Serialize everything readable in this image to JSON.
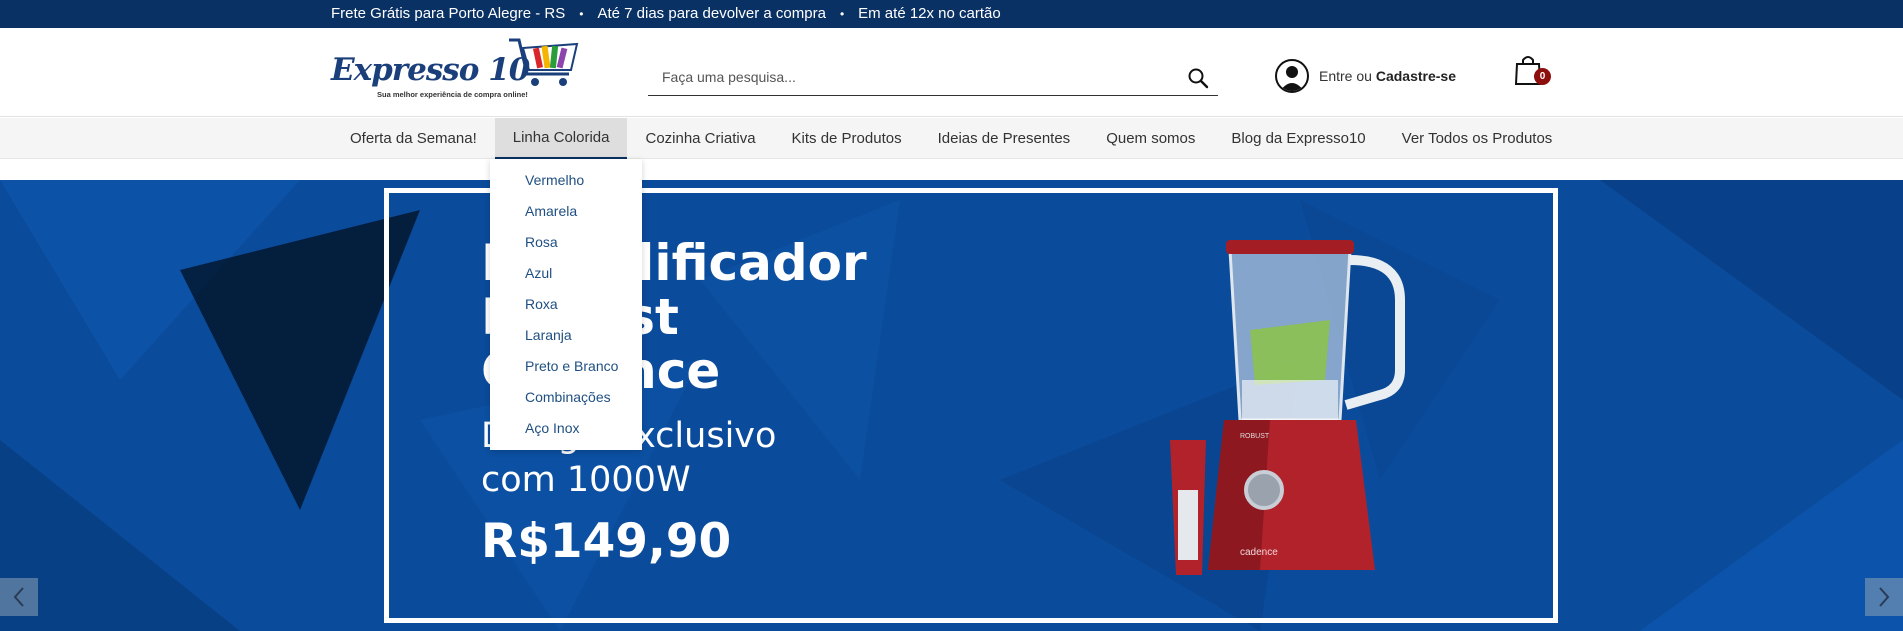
{
  "topbar": {
    "messages": [
      "Frete Grátis para Porto Alegre - RS",
      "Até 7 dias para devolver a compra",
      "Em até 12x no cartão"
    ],
    "separator": "•"
  },
  "logo": {
    "text": "Expresso 10",
    "tagline": "Sua melhor experiência de compra online!"
  },
  "search": {
    "placeholder": "Faça uma pesquisa..."
  },
  "account": {
    "prefix": "Entre ou",
    "register": "Cadastre-se"
  },
  "cart": {
    "count": "0"
  },
  "nav": {
    "items": [
      "Oferta da Semana!",
      "Linha Colorida",
      "Cozinha Criativa",
      "Kits de Produtos",
      "Ideias de Presentes",
      "Quem somos",
      "Blog da Expresso10",
      "Ver Todos os Produtos"
    ],
    "active": "Linha Colorida"
  },
  "dropdown": {
    "items": [
      "Vermelho",
      "Amarela",
      "Rosa",
      "Azul",
      "Roxa",
      "Laranja",
      "Preto e Branco",
      "Combinações",
      "Aço Inox"
    ]
  },
  "banner": {
    "title_line1": "Liquidificador",
    "title_line2": "Robust",
    "title_line3": "Cadence",
    "subtitle_line1": "Design Exclusivo",
    "subtitle_line2": "com 1000W",
    "price": "R$149,90",
    "product_brand": "cadence",
    "product_model": "ROBUST"
  },
  "colors": {
    "topbar": "#0a3163",
    "banner": "#0a4a99",
    "badge": "#8e0d0d",
    "dropdown_text": "#1f4f82"
  }
}
